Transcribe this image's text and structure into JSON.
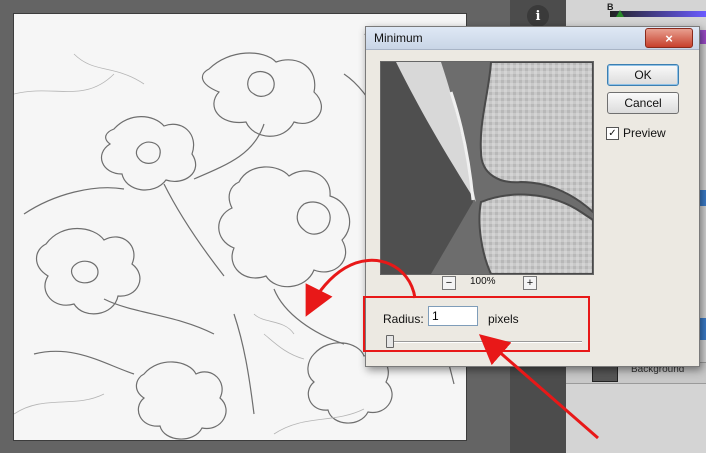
{
  "dialog": {
    "title": "Minimum",
    "close_glyph": "×",
    "ok_label": "OK",
    "cancel_label": "Cancel",
    "preview_label": "Preview",
    "preview_checked": true,
    "check_glyph": "✓",
    "zoom_out_glyph": "−",
    "zoom_in_glyph": "+",
    "zoom_level": "100%",
    "radius_label": "Radius:",
    "radius_value": "1",
    "radius_units": "pixels"
  },
  "panels": {
    "info_glyph": "i",
    "color_slider_label": "B",
    "layer_name": "Background"
  },
  "annotations": {
    "highlight_color": "#e81818"
  },
  "icons": {
    "info": "info-icon",
    "close": "close-icon",
    "check": "checkmark-icon"
  }
}
